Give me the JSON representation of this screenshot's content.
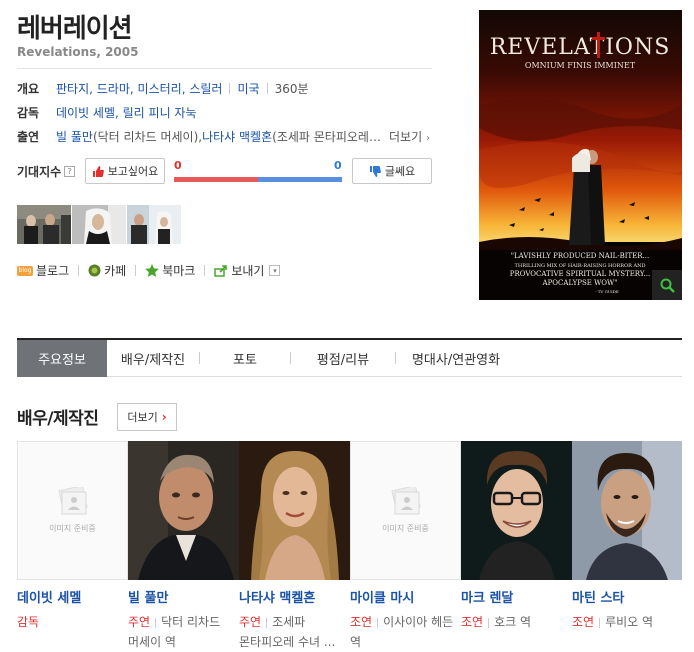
{
  "movie": {
    "title": "레버레이션",
    "subtitle": "Revelations, 2005"
  },
  "info": {
    "overview_label": "개요",
    "genres": [
      "판타지",
      "드라마",
      "미스터리",
      "스릴러"
    ],
    "country": "미국",
    "runtime": "360분",
    "director_label": "감독",
    "directors": "데이빗 세멜, 릴리 피니 자눅",
    "cast_label": "출연",
    "cast_1": "빌 풀만",
    "cast_1_role": "(닥터 리차드 머세이), ",
    "cast_2": "나타샤 맥켈혼",
    "cast_2_role": "(조세파 몬타피오레…",
    "more": "더보기"
  },
  "rating": {
    "label": "기대지수",
    "want_btn": "보고싶어요",
    "nah_btn": "글쎄요",
    "want_count": "0",
    "nah_count": "0",
    "want_share": 0.5
  },
  "share": {
    "blog": "블로그",
    "cafe": "카페",
    "bookmark": "북마크",
    "send": "보내기"
  },
  "poster": {
    "title": "REVELATIONS",
    "tagline": "OMNIUM FINIS IMMINET",
    "quote_1": "\"LAVISHLY PRODUCED NAIL-BITER...",
    "quote_2": "THRILLING MIX OF HAIR-RAISING HORROR AND",
    "quote_3": "PROVOCATIVE SPIRITUAL MYSTERY...",
    "quote_4": "APOCALYPSE WOW\"",
    "quote_src": "- TV GUIDE"
  },
  "tabs": [
    "주요정보",
    "배우/제작진",
    "포토",
    "평점/리뷰",
    "명대사/연관영화"
  ],
  "section": {
    "title": "배우/제작진",
    "more": "더보기",
    "no_image": "이미지 준비중"
  },
  "people": [
    {
      "name": "데이빗 세멜",
      "role": "감독",
      "character": ""
    },
    {
      "name": "빌 풀만",
      "role": "주연",
      "character": "닥터 리차드 머세이 역"
    },
    {
      "name": "나타샤 맥켈혼",
      "role": "주연",
      "character": "조세파 몬타피오레 수녀 ..."
    },
    {
      "name": "마이클 마시",
      "role": "조연",
      "character": "이사이아 헤든 역"
    },
    {
      "name": "마크 렌달",
      "role": "조연",
      "character": "호크 역"
    },
    {
      "name": "마틴 스타",
      "role": "조연",
      "character": "루비오 역"
    }
  ]
}
